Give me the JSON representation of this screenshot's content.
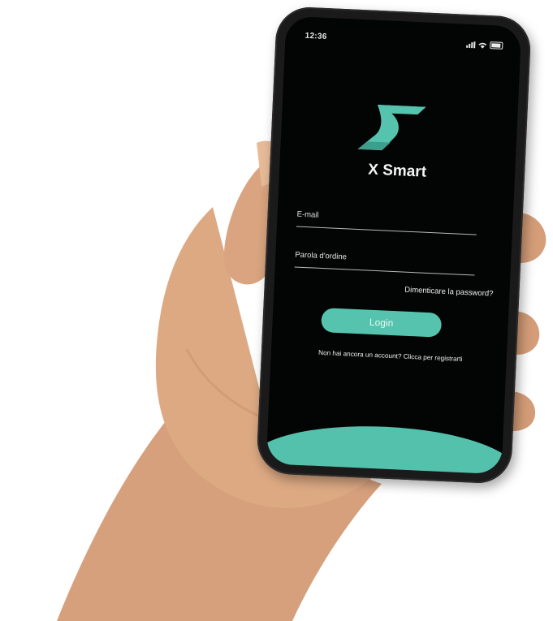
{
  "status_bar": {
    "time": "12:36"
  },
  "app": {
    "title": "X Smart"
  },
  "login_form": {
    "email_label": "E-mail",
    "password_label": "Parola d'ordine",
    "forgot_password": "Dimenticare la password?",
    "login_button": "Login",
    "register_prompt": "Non hai ancora un account? Clicca per registrarti"
  },
  "colors": {
    "accent": "#55c3ad",
    "screen_background": "#030404",
    "text": "#f0f0f0",
    "skin": "#d9a47f"
  },
  "icons": [
    "x-smart-logo-icon",
    "signal-icon",
    "wifi-icon",
    "battery-icon"
  ]
}
